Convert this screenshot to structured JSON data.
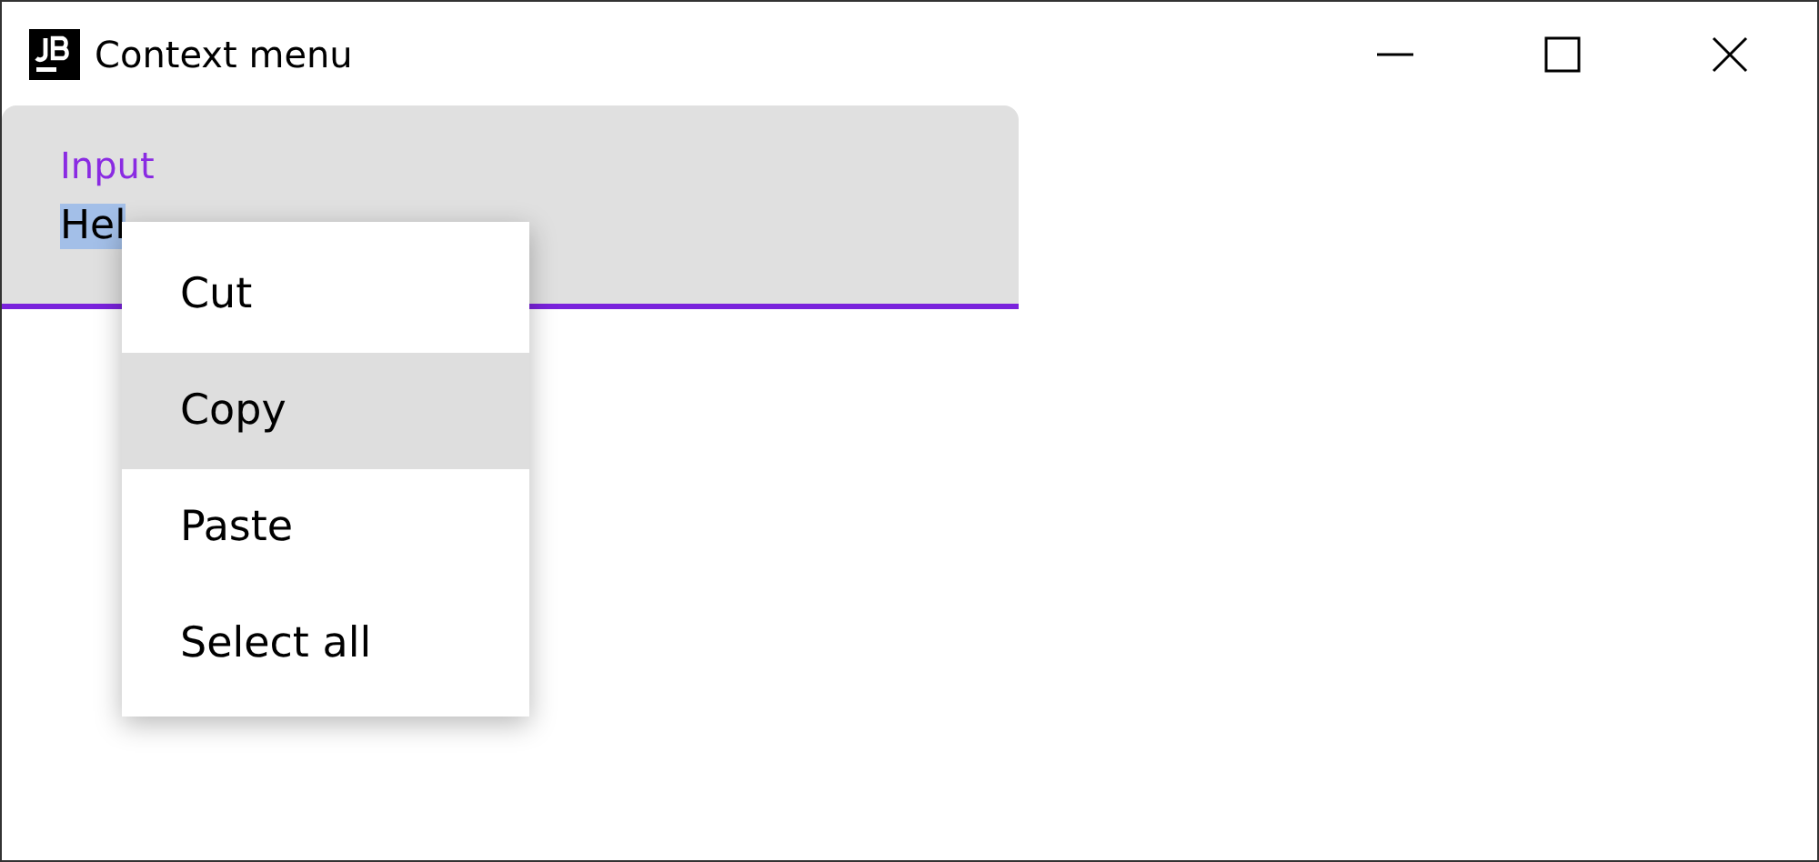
{
  "window": {
    "title": "Context menu"
  },
  "field": {
    "label": "Input",
    "focused": true,
    "value": [
      {
        "text": "Hel",
        "selected": true
      }
    ]
  },
  "context_menu": {
    "items": [
      {
        "label": "Cut",
        "highlighted": false
      },
      {
        "label": "Copy",
        "highlighted": true
      },
      {
        "label": "Paste",
        "highlighted": false
      },
      {
        "label": "Select all",
        "highlighted": false
      }
    ]
  }
}
